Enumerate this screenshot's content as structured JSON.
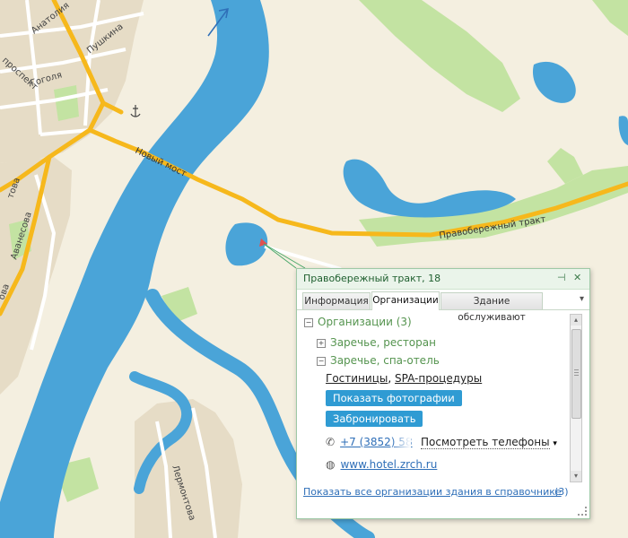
{
  "map": {
    "streets": [
      "Анатолия",
      "Пушкина",
      "Гоголя",
      "проспект",
      "Новый мост",
      "Правобережный тракт",
      "Аванесова",
      "товa",
      "Лермонтова",
      "ова"
    ],
    "colors": {
      "water": "#4aa4d8",
      "land": "#f4efe0",
      "urban": "#e6dcc6",
      "green": "#c3e3a2",
      "road": "#f6b81c",
      "minor_road": "#ffffff"
    }
  },
  "popup": {
    "title": "Правобережный тракт, 18",
    "pin_icon": "pin-icon",
    "close_icon": "close-icon",
    "tabs": [
      "Информация",
      "Организации",
      "Здание обслуживают"
    ],
    "active_tab": "Организации",
    "tree": {
      "root": {
        "label": "Организации",
        "count": "(3)"
      },
      "items": [
        {
          "label": "Заречье, ресторан",
          "state": "collapsed"
        },
        {
          "label": "Заречье, спа-отель",
          "state": "expanded"
        }
      ],
      "rubrics": [
        "Гостиницы",
        "SPA-процедуры"
      ],
      "rubric_separator": ",",
      "buttons": {
        "photos": "Показать фотографии",
        "book": "Забронировать"
      },
      "phone": "+7 (3852) 58",
      "show_phones": "Посмотреть телефоны",
      "website": "www.hotel.zrch.ru"
    },
    "footer": {
      "link": "Показать все организации здания в справочнике",
      "count": "(3)"
    }
  }
}
